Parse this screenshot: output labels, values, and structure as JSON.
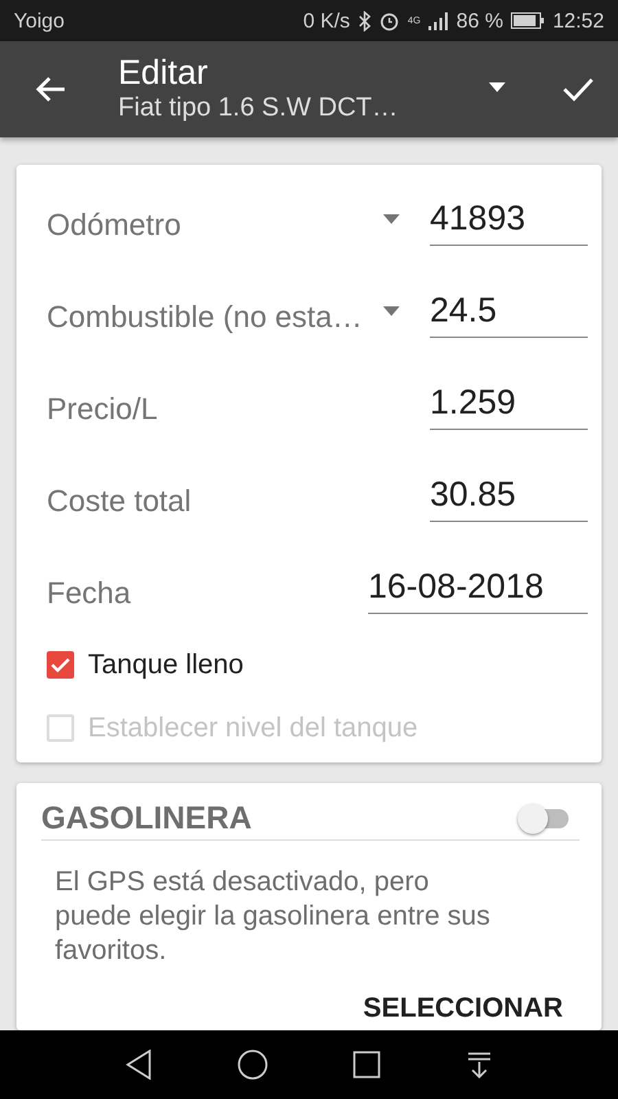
{
  "status_bar": {
    "carrier": "Yoigo",
    "speed": "0 K/s",
    "network": "4G",
    "battery": "86 %",
    "time": "12:52"
  },
  "toolbar": {
    "title": "Editar",
    "subtitle": "Fiat tipo 1.6 S.W DCT…"
  },
  "fields": [
    {
      "kind": "dropdown",
      "label": "Odómetro",
      "value": "41893"
    },
    {
      "kind": "dropdown",
      "label": "Combustible (no esta…",
      "value": "24.5"
    },
    {
      "kind": "plain",
      "label": "Precio/L",
      "value": "1.259"
    },
    {
      "kind": "plain",
      "label": "Coste total",
      "value": "30.85"
    },
    {
      "kind": "date",
      "label": "Fecha",
      "value": "16-08-2018"
    }
  ],
  "checkboxes": [
    {
      "label": "Tanque lleno",
      "checked": true,
      "disabled": false
    },
    {
      "label": "Establecer nivel del tanque",
      "checked": false,
      "disabled": true
    }
  ],
  "station": {
    "title": "GASOLINERA",
    "on": false,
    "message": "El GPS está desactivado, pero puede elegir la gasolinera entre sus favoritos.",
    "action": "SELECCIONAR"
  }
}
